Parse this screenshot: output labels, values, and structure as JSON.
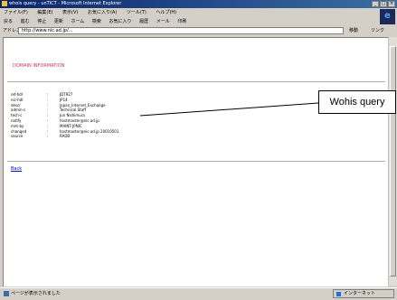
{
  "window": {
    "title": "whois query - unTICT - Microsoft Internet Explorer"
  },
  "menubar": {
    "items": [
      "ファイル(F)",
      "編集(E)",
      "表示(V)",
      "お気に入り(A)",
      "ツール(T)",
      "ヘルプ(H)"
    ]
  },
  "toolbar": {
    "items": [
      "戻る",
      "進む",
      "停止",
      "更新",
      "ホーム",
      "検索",
      "お気に入り",
      "履歴",
      "メール",
      "印刷"
    ]
  },
  "addressbar": {
    "label": "アドレス(D)",
    "url": "http://www.nic.ad.jp/...",
    "go_label": "移動",
    "links_label": "リンク"
  },
  "page": {
    "heading": "DOMAIN INFORMATION",
    "record": [
      {
        "key": "ref-hdl",
        "value": "JDT927"
      },
      {
        "key": "nic-hdl",
        "value": "JP14"
      },
      {
        "key": "descr",
        "value": "Japan_Internet_Exchange"
      },
      {
        "key": "admin-c",
        "value": "Technical Staff"
      },
      {
        "key": "tech-c",
        "value": "Jun Nishimura"
      },
      {
        "key": "notify",
        "value": "hostmaster@nic.ad.jp"
      },
      {
        "key": "mnt-by",
        "value": "MAINT-JPNIC"
      },
      {
        "key": "changed",
        "value": "hostmaster@nic.ad.jp 20010501"
      },
      {
        "key": "source",
        "value": "RADB"
      }
    ],
    "back_link": "Back"
  },
  "callout": {
    "text": "Wohis query"
  },
  "statusbar": {
    "text": "ページが表示されました",
    "zone": "インターネット"
  }
}
